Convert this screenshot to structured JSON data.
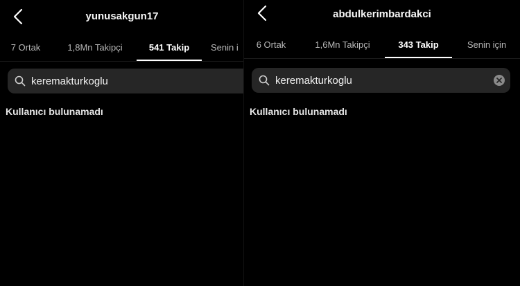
{
  "left": {
    "username": "yunusakgun17",
    "tabs": [
      {
        "label": "7 Ortak"
      },
      {
        "label": "1,8Mn Takipçi"
      },
      {
        "label": "541 Takip"
      },
      {
        "label": "Senin i"
      }
    ],
    "active_tab_index": 2,
    "search": {
      "value": "keremakturkoglu"
    },
    "empty_message": "Kullanıcı bulunamadı"
  },
  "right": {
    "username": "abdulkerimbardakci",
    "tabs": [
      {
        "label": "6 Ortak"
      },
      {
        "label": "1,6Mn Takipçi"
      },
      {
        "label": "343 Takip"
      },
      {
        "label": "Senin için"
      }
    ],
    "active_tab_index": 2,
    "search": {
      "value": "keremakturkoglu"
    },
    "empty_message": "Kullanıcı bulunamadı"
  },
  "icons": {
    "back": "chevron-left-icon",
    "search": "search-icon",
    "clear": "clear-icon"
  },
  "colors": {
    "background": "#000000",
    "search_field": "#262626",
    "active_tab": "#ffffff",
    "inactive_tab": "#b8b8b8"
  }
}
